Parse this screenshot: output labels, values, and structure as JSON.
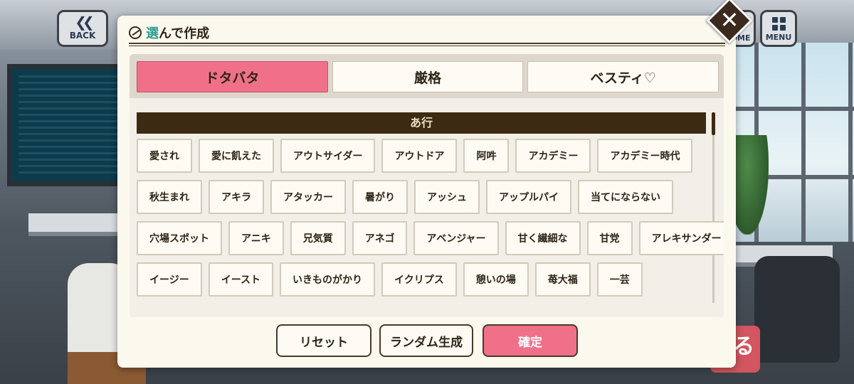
{
  "hud": {
    "back_label": "BACK",
    "menu_label": "MENU",
    "home_label": "HOME",
    "bg_button_char": "る"
  },
  "dialog": {
    "title_accent": "選",
    "title_rest": "んで作成",
    "close_glyph": "✕",
    "tabs": [
      {
        "label": "ドタバタ",
        "active": true
      },
      {
        "label": "厳格",
        "active": false
      },
      {
        "label": "ベスティ♡",
        "active": false
      }
    ],
    "section_header": "あ行",
    "rows": [
      [
        "愛され",
        "愛に飢えた",
        "アウトサイダー",
        "アウトドア",
        "阿吽",
        "アカデミー",
        "アカデミー時代"
      ],
      [
        "秋生まれ",
        "アキラ",
        "アタッカー",
        "暑がり",
        "アッシュ",
        "アップルパイ",
        "当てにならない"
      ],
      [
        "穴場スポット",
        "アニキ",
        "兄気質",
        "アネゴ",
        "アベンジャー",
        "甘く繊細な",
        "甘党",
        "アレキサンダー"
      ],
      [
        "イージー",
        "イースト",
        "いきものがかり",
        "イクリプス",
        "憩いの場",
        "苺大福",
        "一芸"
      ]
    ],
    "buttons": {
      "reset": "リセット",
      "random": "ランダム生成",
      "confirm": "確定"
    }
  },
  "colors": {
    "accent_pink": "#f0708a",
    "header_brown": "#3d2a12",
    "title_teal": "#2f9c8f"
  }
}
